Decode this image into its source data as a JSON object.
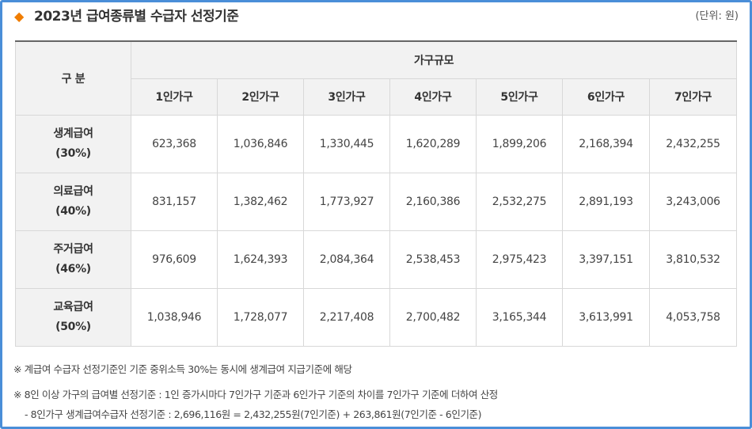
{
  "header": {
    "title": "2023년 급여종류별 수급자 선정기준",
    "unit": "(단위: 원)",
    "marker_color": "#f07d00",
    "border_color": "#4a8ed8"
  },
  "table": {
    "corner_label": "구 분",
    "group_label": "가구규모",
    "columns": [
      "1인가구",
      "2인가구",
      "3인가구",
      "4인가구",
      "5인가구",
      "6인가구",
      "7인가구"
    ],
    "rows": [
      {
        "name": "생계급여",
        "ratio": "(30%)",
        "values": [
          "623,368",
          "1,036,846",
          "1,330,445",
          "1,620,289",
          "1,899,206",
          "2,168,394",
          "2,432,255"
        ]
      },
      {
        "name": "의료급여",
        "ratio": "(40%)",
        "values": [
          "831,157",
          "1,382,462",
          "1,773,927",
          "2,160,386",
          "2,532,275",
          "2,891,193",
          "3,243,006"
        ]
      },
      {
        "name": "주거급여",
        "ratio": "(46%)",
        "values": [
          "976,609",
          "1,624,393",
          "2,084,364",
          "2,538,453",
          "2,975,423",
          "3,397,151",
          "3,810,532"
        ]
      },
      {
        "name": "교육급여",
        "ratio": "(50%)",
        "values": [
          "1,038,946",
          "1,728,077",
          "2,217,408",
          "2,700,482",
          "3,165,344",
          "3,613,991",
          "4,053,758"
        ]
      }
    ]
  },
  "notes": {
    "note1": "※ 계급여 수급자 선정기준인 기준 중위소득 30%는 동시에 생계급여 지급기준에 해당",
    "note2": "※ 8인 이상 가구의 급여별 선정기준 : 1인 증가시마다 7인가구 기준과 6인가구 기준의 차이를 7인가구 기준에 더하여 산정",
    "note3": "- 8인가구 생계급여수급자 선정기준 : 2,696,116원 = 2,432,255원(7인기준) + 263,861원(7인기준 - 6인기준)"
  }
}
